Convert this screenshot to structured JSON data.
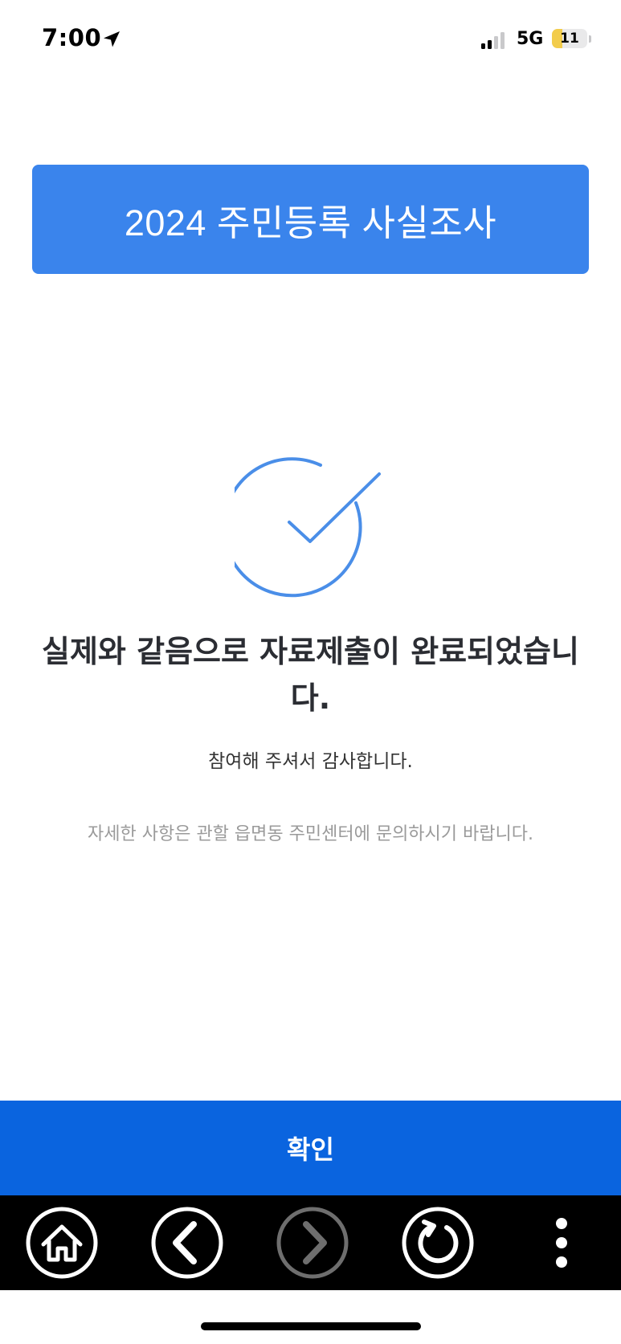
{
  "status_bar": {
    "time": "7:00",
    "network": "5G",
    "battery_level": "11",
    "battery_fraction": 0.11,
    "icons": [
      "location-arrow-icon",
      "signal-icon",
      "battery-icon"
    ]
  },
  "banner": {
    "title": "2024 주민등록 사실조사",
    "color": "#3a84ec"
  },
  "result": {
    "icon": "check-circle-icon",
    "heading": "실제와 같음으로 자료제출이 완료되었습니다.",
    "thanks": "참여해 주셔서 감사합니다.",
    "inquiry": "자세한 사항은 관할 읍면동 주민센터에 문의하시기 바랍니다."
  },
  "confirm": {
    "label": "확인",
    "color": "#0a64df"
  },
  "toolbar": {
    "items": [
      {
        "name": "home-icon",
        "enabled": true
      },
      {
        "name": "back-arrow-icon",
        "enabled": true
      },
      {
        "name": "forward-arrow-icon",
        "enabled": false
      },
      {
        "name": "refresh-icon",
        "enabled": true
      },
      {
        "name": "more-vertical-icon",
        "enabled": true
      }
    ]
  }
}
